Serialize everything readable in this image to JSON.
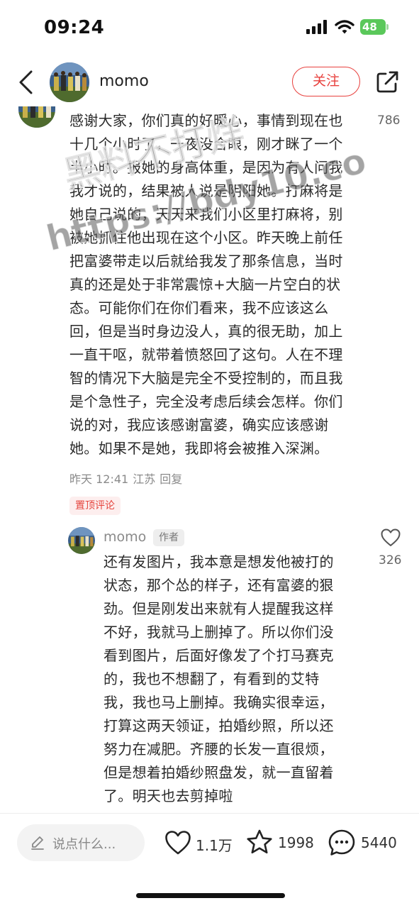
{
  "status_bar": {
    "time": "09:24",
    "battery": "48"
  },
  "header": {
    "username": "momo",
    "follow_label": "关注"
  },
  "comment": {
    "likes": "786",
    "lines": [
      "感谢大家，你们真的好暖心，事情到现在也",
      "十几个小时了，一夜没合眼，刚才眯了一个",
      "半小时。报她的身高体重，是因为有人问我",
      "我才说的，结果被人说是阴阳她。打麻将是",
      "她自己说的，天天来我们小区里打麻将，别",
      "被她抓住他出现在这个小区。昨天晚上前任",
      "把富婆带走以后就给我发了那条信息，当时",
      "真的还是处于非常震惊+大脑一片空白的状",
      "态。可能你们在你们看来，我不应该这么",
      "回，但是当时身边没人，真的很无助，加上",
      "一直干呕，就带着愤怒回了这句。人在不理",
      "智的情况下大脑是完全不受控制的，而且我",
      "是个急性子，完全没考虑后续会怎样。你们",
      "说的对，我应该感谢富婆，确实应该感谢",
      "她。如果不是她，我即将会被推入深渊。"
    ],
    "time": "昨天 12:41",
    "location": "江苏",
    "reply_label": "回复",
    "pinned_label": "置顶评论"
  },
  "reply": {
    "username": "momo",
    "author_badge": "作者",
    "likes": "326",
    "lines": [
      "还有发图片，我本意是想发他被打的",
      "状态，那个怂的样子，还有富婆的狠",
      "劲。但是刚发出来就有人提醒我这样",
      "不好，我就马上删掉了。所以你们没",
      "看到图片，后面好像发了个打马赛克",
      "的，我也不想翻了，有看到的艾特",
      "我，我也马上删掉。我确实很幸运，",
      "打算这两天领证，拍婚纱照，所以还",
      "努力在减肥。齐腰的长发一直很烦，",
      "但是想着拍婚纱照盘发，就一直留着",
      "了。明天也去剪掉啦"
    ]
  },
  "bottom_bar": {
    "input_placeholder": "说点什么...",
    "like_count": "1.1万",
    "star_count": "1998",
    "comment_count": "5440"
  },
  "watermark": {
    "line1": "黑料不打烊",
    "line2": "https://bdy10.co"
  },
  "colors": {
    "accent": "#e8413e",
    "battery": "#5ac85a",
    "text": "#2a2a2a",
    "muted": "#8a8a8a"
  }
}
